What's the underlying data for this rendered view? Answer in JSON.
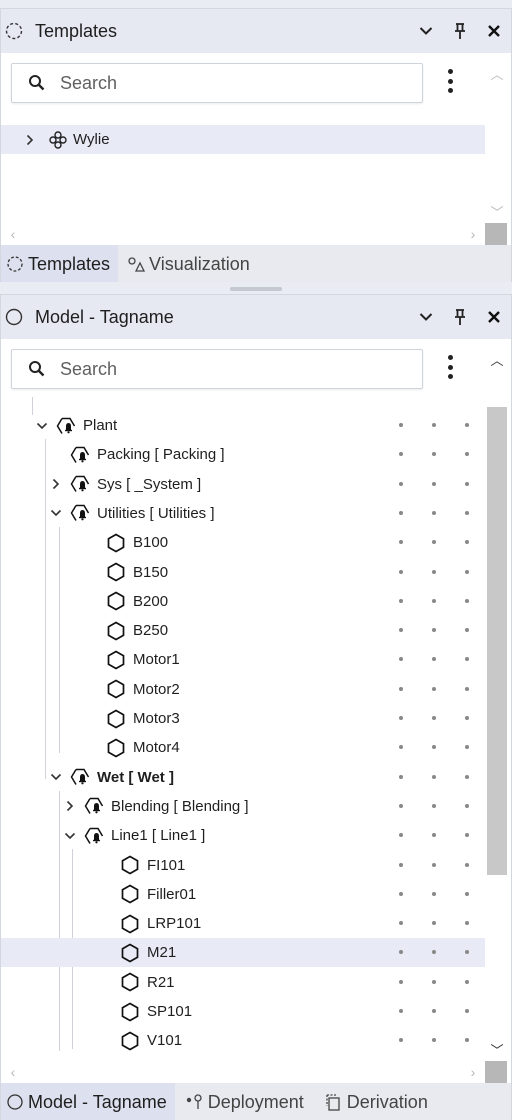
{
  "templates_pane": {
    "title": "Templates",
    "search_placeholder": "Search",
    "tree": [
      {
        "label": "Wylie",
        "icon": "template-group-icon",
        "expander": "collapsed"
      }
    ],
    "tabs": [
      {
        "label": "Templates",
        "icon": "templates-tab-icon",
        "active": true
      },
      {
        "label": "Visualization",
        "icon": "visualization-icon",
        "active": false
      }
    ]
  },
  "model_pane": {
    "title": "Model - Tagname",
    "search_placeholder": "Search",
    "tree": [
      {
        "label": "Plant",
        "type": "area",
        "expander": "expanded",
        "bold": false
      },
      {
        "label": "Packing [ Packing ]",
        "type": "area",
        "expander": "none",
        "bold": false
      },
      {
        "label": "Sys [ _System ]",
        "type": "area",
        "expander": "collapsed",
        "bold": false
      },
      {
        "label": "Utilities [ Utilities ]",
        "type": "area",
        "expander": "expanded",
        "bold": false
      },
      {
        "label": "B100",
        "type": "object",
        "expander": "none",
        "bold": false
      },
      {
        "label": "B150",
        "type": "object",
        "expander": "none",
        "bold": false
      },
      {
        "label": "B200",
        "type": "object",
        "expander": "none",
        "bold": false
      },
      {
        "label": "B250",
        "type": "object",
        "expander": "none",
        "bold": false
      },
      {
        "label": "Motor1",
        "type": "object",
        "expander": "none",
        "bold": false
      },
      {
        "label": "Motor2",
        "type": "object",
        "expander": "none",
        "bold": false
      },
      {
        "label": "Motor3",
        "type": "object",
        "expander": "none",
        "bold": false
      },
      {
        "label": "Motor4",
        "type": "object",
        "expander": "none",
        "bold": false
      },
      {
        "label": "Wet [ Wet ]",
        "type": "area",
        "expander": "expanded",
        "bold": true
      },
      {
        "label": "Blending [ Blending ]",
        "type": "area",
        "expander": "collapsed",
        "bold": false
      },
      {
        "label": "Line1 [ Line1 ]",
        "type": "area",
        "expander": "expanded",
        "bold": false
      },
      {
        "label": "FI101",
        "type": "object",
        "expander": "none",
        "bold": false
      },
      {
        "label": "Filler01",
        "type": "object",
        "expander": "none",
        "bold": false
      },
      {
        "label": "LRP101",
        "type": "object",
        "expander": "none",
        "bold": false
      },
      {
        "label": "M21",
        "type": "object",
        "expander": "none",
        "bold": false,
        "selected": true
      },
      {
        "label": "R21",
        "type": "object",
        "expander": "none",
        "bold": false
      },
      {
        "label": "SP101",
        "type": "object",
        "expander": "none",
        "bold": false
      },
      {
        "label": "V101",
        "type": "object",
        "expander": "none",
        "bold": false
      }
    ],
    "tabs": [
      {
        "label": "Model - Tagname",
        "icon": "model-tab-icon",
        "active": true
      },
      {
        "label": "Deployment",
        "icon": "deployment-icon",
        "active": false
      },
      {
        "label": "Derivation",
        "icon": "derivation-icon",
        "active": false
      }
    ]
  },
  "colors": {
    "header_bg": "#e6e8f2",
    "selection_bg": "#e8eaf6",
    "tab_active_bg": "#dde0ee"
  }
}
